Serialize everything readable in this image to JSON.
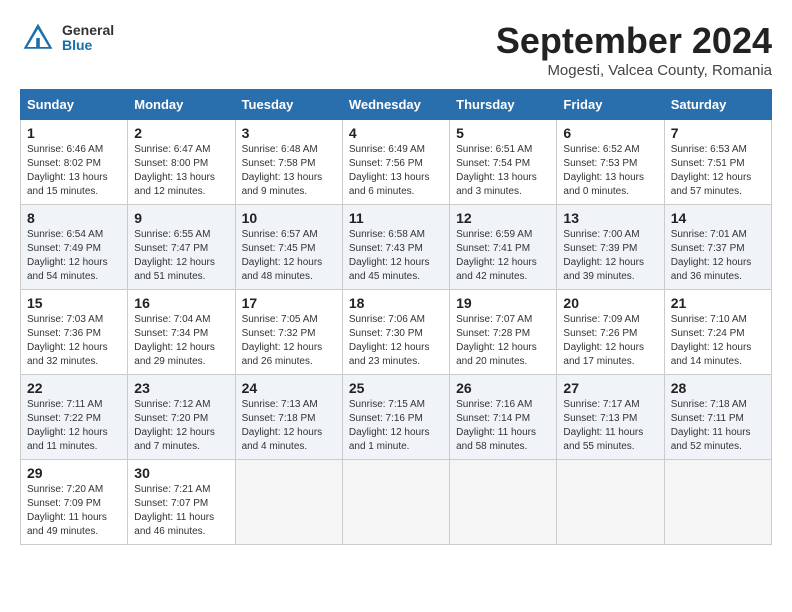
{
  "header": {
    "logo_general": "General",
    "logo_blue": "Blue",
    "month_title": "September 2024",
    "location": "Mogesti, Valcea County, Romania"
  },
  "columns": [
    "Sunday",
    "Monday",
    "Tuesday",
    "Wednesday",
    "Thursday",
    "Friday",
    "Saturday"
  ],
  "weeks": [
    [
      {
        "day": "1",
        "info": "Sunrise: 6:46 AM\nSunset: 8:02 PM\nDaylight: 13 hours\nand 15 minutes."
      },
      {
        "day": "2",
        "info": "Sunrise: 6:47 AM\nSunset: 8:00 PM\nDaylight: 13 hours\nand 12 minutes."
      },
      {
        "day": "3",
        "info": "Sunrise: 6:48 AM\nSunset: 7:58 PM\nDaylight: 13 hours\nand 9 minutes."
      },
      {
        "day": "4",
        "info": "Sunrise: 6:49 AM\nSunset: 7:56 PM\nDaylight: 13 hours\nand 6 minutes."
      },
      {
        "day": "5",
        "info": "Sunrise: 6:51 AM\nSunset: 7:54 PM\nDaylight: 13 hours\nand 3 minutes."
      },
      {
        "day": "6",
        "info": "Sunrise: 6:52 AM\nSunset: 7:53 PM\nDaylight: 13 hours\nand 0 minutes."
      },
      {
        "day": "7",
        "info": "Sunrise: 6:53 AM\nSunset: 7:51 PM\nDaylight: 12 hours\nand 57 minutes."
      }
    ],
    [
      {
        "day": "8",
        "info": "Sunrise: 6:54 AM\nSunset: 7:49 PM\nDaylight: 12 hours\nand 54 minutes."
      },
      {
        "day": "9",
        "info": "Sunrise: 6:55 AM\nSunset: 7:47 PM\nDaylight: 12 hours\nand 51 minutes."
      },
      {
        "day": "10",
        "info": "Sunrise: 6:57 AM\nSunset: 7:45 PM\nDaylight: 12 hours\nand 48 minutes."
      },
      {
        "day": "11",
        "info": "Sunrise: 6:58 AM\nSunset: 7:43 PM\nDaylight: 12 hours\nand 45 minutes."
      },
      {
        "day": "12",
        "info": "Sunrise: 6:59 AM\nSunset: 7:41 PM\nDaylight: 12 hours\nand 42 minutes."
      },
      {
        "day": "13",
        "info": "Sunrise: 7:00 AM\nSunset: 7:39 PM\nDaylight: 12 hours\nand 39 minutes."
      },
      {
        "day": "14",
        "info": "Sunrise: 7:01 AM\nSunset: 7:37 PM\nDaylight: 12 hours\nand 36 minutes."
      }
    ],
    [
      {
        "day": "15",
        "info": "Sunrise: 7:03 AM\nSunset: 7:36 PM\nDaylight: 12 hours\nand 32 minutes."
      },
      {
        "day": "16",
        "info": "Sunrise: 7:04 AM\nSunset: 7:34 PM\nDaylight: 12 hours\nand 29 minutes."
      },
      {
        "day": "17",
        "info": "Sunrise: 7:05 AM\nSunset: 7:32 PM\nDaylight: 12 hours\nand 26 minutes."
      },
      {
        "day": "18",
        "info": "Sunrise: 7:06 AM\nSunset: 7:30 PM\nDaylight: 12 hours\nand 23 minutes."
      },
      {
        "day": "19",
        "info": "Sunrise: 7:07 AM\nSunset: 7:28 PM\nDaylight: 12 hours\nand 20 minutes."
      },
      {
        "day": "20",
        "info": "Sunrise: 7:09 AM\nSunset: 7:26 PM\nDaylight: 12 hours\nand 17 minutes."
      },
      {
        "day": "21",
        "info": "Sunrise: 7:10 AM\nSunset: 7:24 PM\nDaylight: 12 hours\nand 14 minutes."
      }
    ],
    [
      {
        "day": "22",
        "info": "Sunrise: 7:11 AM\nSunset: 7:22 PM\nDaylight: 12 hours\nand 11 minutes."
      },
      {
        "day": "23",
        "info": "Sunrise: 7:12 AM\nSunset: 7:20 PM\nDaylight: 12 hours\nand 7 minutes."
      },
      {
        "day": "24",
        "info": "Sunrise: 7:13 AM\nSunset: 7:18 PM\nDaylight: 12 hours\nand 4 minutes."
      },
      {
        "day": "25",
        "info": "Sunrise: 7:15 AM\nSunset: 7:16 PM\nDaylight: 12 hours\nand 1 minute."
      },
      {
        "day": "26",
        "info": "Sunrise: 7:16 AM\nSunset: 7:14 PM\nDaylight: 11 hours\nand 58 minutes."
      },
      {
        "day": "27",
        "info": "Sunrise: 7:17 AM\nSunset: 7:13 PM\nDaylight: 11 hours\nand 55 minutes."
      },
      {
        "day": "28",
        "info": "Sunrise: 7:18 AM\nSunset: 7:11 PM\nDaylight: 11 hours\nand 52 minutes."
      }
    ],
    [
      {
        "day": "29",
        "info": "Sunrise: 7:20 AM\nSunset: 7:09 PM\nDaylight: 11 hours\nand 49 minutes."
      },
      {
        "day": "30",
        "info": "Sunrise: 7:21 AM\nSunset: 7:07 PM\nDaylight: 11 hours\nand 46 minutes."
      },
      {
        "day": "",
        "info": ""
      },
      {
        "day": "",
        "info": ""
      },
      {
        "day": "",
        "info": ""
      },
      {
        "day": "",
        "info": ""
      },
      {
        "day": "",
        "info": ""
      }
    ]
  ]
}
